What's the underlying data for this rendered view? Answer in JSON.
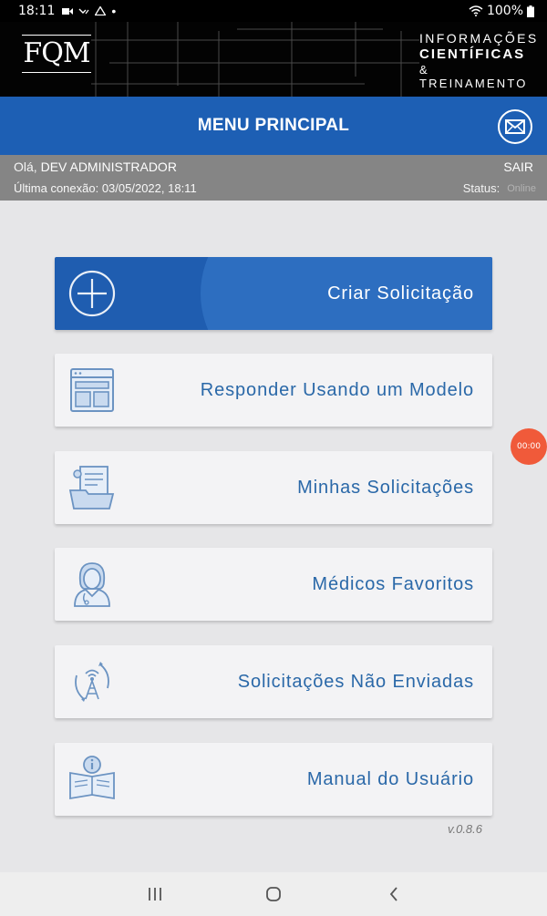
{
  "statusbar": {
    "time": "18:11",
    "battery": "100%"
  },
  "brand": {
    "logo": "FQM",
    "line1": "INFORMAÇÕES",
    "line2": "CIENTÍFICAS",
    "line3": "& TREINAMENTO"
  },
  "header": {
    "title": "MENU PRINCIPAL"
  },
  "user": {
    "greeting": "Olá,",
    "name": "DEV ADMINISTRADOR",
    "last_connection": "Última conexão: 03/05/2022, 18:11",
    "logout": "SAIR",
    "status_label": "Status:",
    "status_value": "Online"
  },
  "menu": {
    "items": [
      {
        "label": "Criar Solicitação",
        "icon": "plus-circle-icon"
      },
      {
        "label": "Responder Usando um Modelo",
        "icon": "template-icon"
      },
      {
        "label": "Minhas Solicitações",
        "icon": "folder-documents-icon"
      },
      {
        "label": "Médicos Favoritos",
        "icon": "doctor-icon"
      },
      {
        "label": "Solicitações Não Enviadas",
        "icon": "antenna-icon"
      },
      {
        "label": "Manual do Usuário",
        "icon": "manual-book-icon"
      }
    ]
  },
  "version": "v.0.8.6",
  "timer": "00:00",
  "colors": {
    "primary": "#1d5fb4",
    "card_text": "#2a68a8",
    "timer": "#f05a3a"
  }
}
